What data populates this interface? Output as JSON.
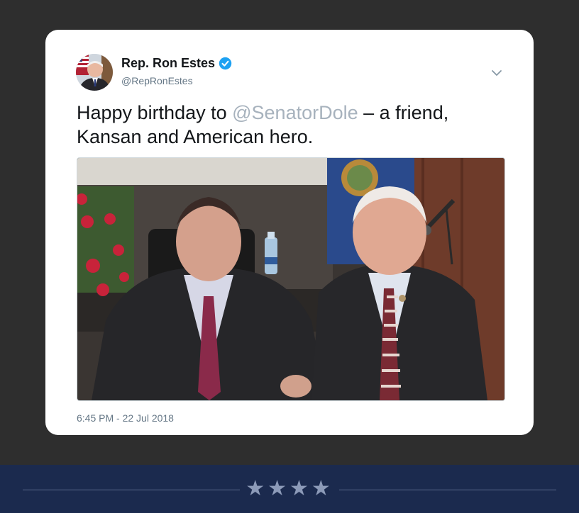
{
  "tweet": {
    "author_name": "Rep. Ron Estes",
    "handle": "@RepRonEstes",
    "text_before": "Happy birthday to ",
    "mention": "@SenatorDole",
    "text_after": " – a friend, Kansan and American hero.",
    "timestamp": "6:45 PM - 22 Jul 2018",
    "verified": true
  },
  "icons": {
    "verified": "verified-badge-icon",
    "menu": "chevron-down-icon"
  },
  "footer": {
    "stars": "★★★★"
  },
  "colors": {
    "page_background": "#2e2e2e",
    "card": "#ffffff",
    "verified": "#1da1f2",
    "mention": "#a7b2bd",
    "footer": "#1b2a4e"
  }
}
